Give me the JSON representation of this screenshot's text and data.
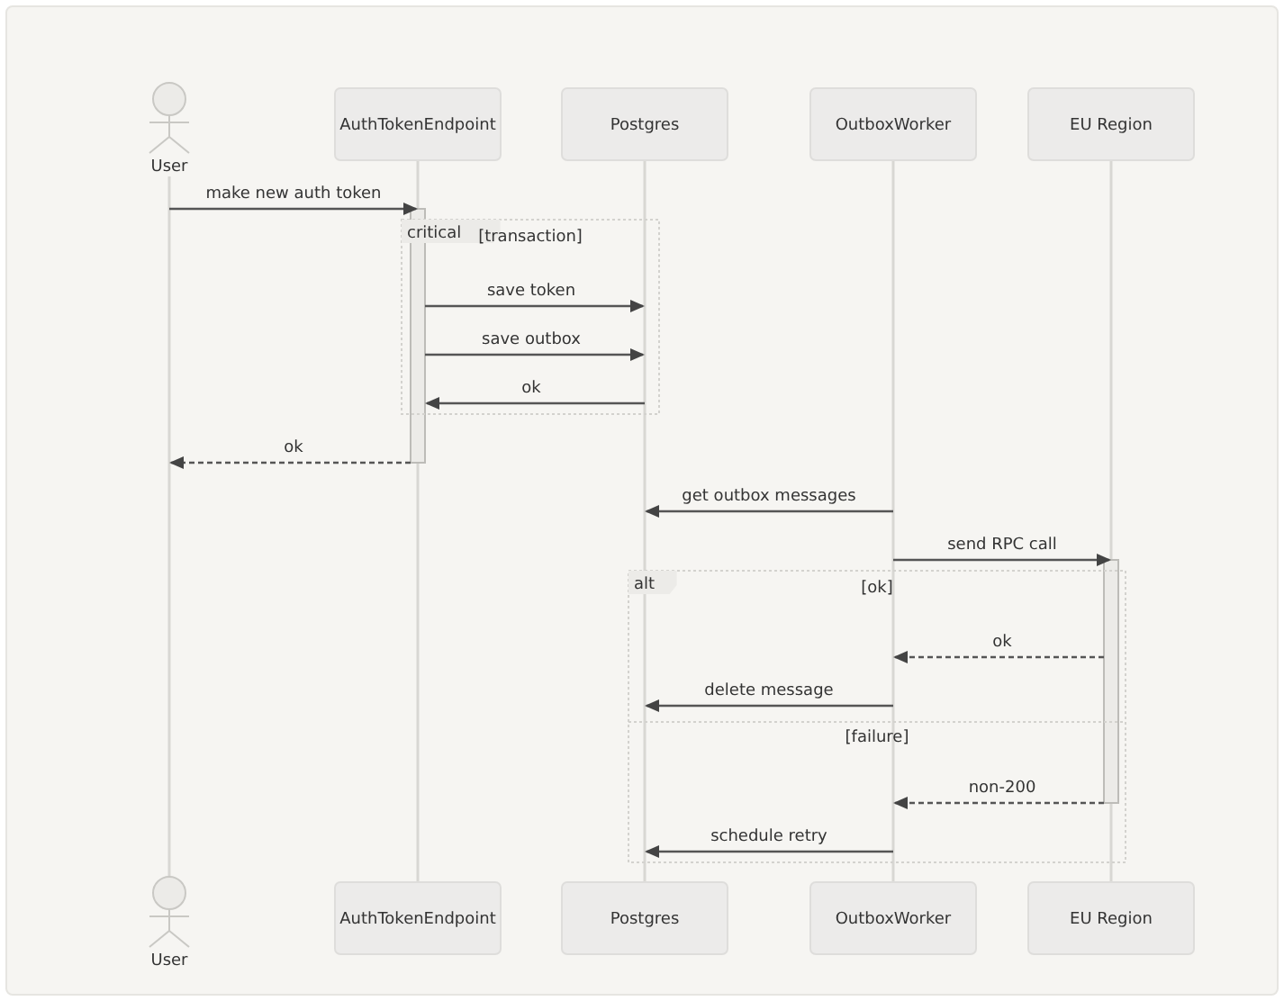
{
  "participants_top": [
    {
      "name": "User",
      "kind": "actor"
    },
    {
      "name": "AuthTokenEndpoint",
      "kind": "box"
    },
    {
      "name": "Postgres",
      "kind": "box"
    },
    {
      "name": "OutboxWorker",
      "kind": "box"
    },
    {
      "name": "EU Region",
      "kind": "box"
    }
  ],
  "events": [
    {
      "kind": "call",
      "label": "make new auth token",
      "activate": true
    },
    {
      "kind": "frame",
      "label": "critical",
      "sections": [
        {
          "condition": "[transaction]",
          "events": [
            {
              "kind": "call",
              "label": "save token"
            },
            {
              "kind": "call",
              "label": "save outbox"
            },
            {
              "kind": "call",
              "label": "ok"
            }
          ]
        }
      ]
    },
    {
      "kind": "reply",
      "label": "ok",
      "deactivate": true
    },
    {
      "kind": "call",
      "label": "get outbox messages"
    },
    {
      "kind": "call",
      "label": "send RPC call",
      "activate": true
    },
    {
      "kind": "frame",
      "label": "alt",
      "sections": [
        {
          "condition": "[ok]",
          "events": [
            {
              "kind": "reply",
              "label": "ok"
            },
            {
              "kind": "call",
              "label": "delete message"
            }
          ]
        },
        {
          "condition": "[failure]",
          "events": [
            {
              "kind": "reply",
              "label": "non-200",
              "deactivate": true
            },
            {
              "kind": "call",
              "label": "schedule retry"
            }
          ]
        }
      ]
    }
  ],
  "participants_bottom": [
    {
      "name": "User",
      "kind": "actor"
    },
    {
      "name": "AuthTokenEndpoint",
      "kind": "box"
    },
    {
      "name": "Postgres",
      "kind": "box"
    },
    {
      "name": "OutboxWorker",
      "kind": "box"
    },
    {
      "name": "EU Region",
      "kind": "box"
    }
  ]
}
